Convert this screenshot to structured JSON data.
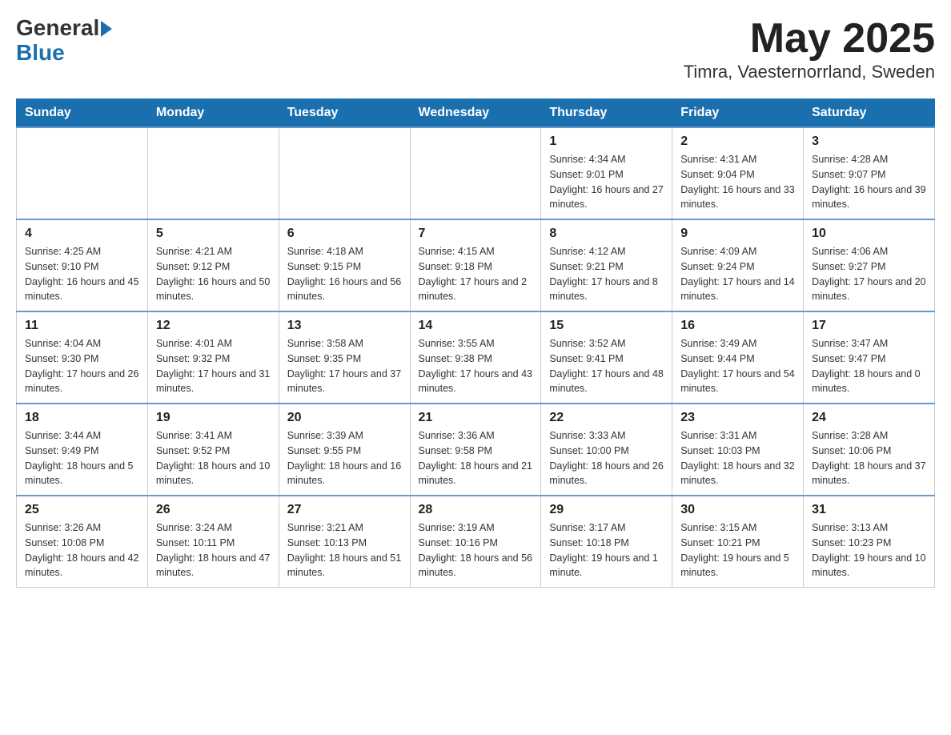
{
  "header": {
    "logo_general": "General",
    "logo_blue": "Blue",
    "title": "May 2025",
    "subtitle": "Timra, Vaesternorrland, Sweden"
  },
  "days_of_week": [
    "Sunday",
    "Monday",
    "Tuesday",
    "Wednesday",
    "Thursday",
    "Friday",
    "Saturday"
  ],
  "weeks": [
    [
      {
        "day": "",
        "info": ""
      },
      {
        "day": "",
        "info": ""
      },
      {
        "day": "",
        "info": ""
      },
      {
        "day": "",
        "info": ""
      },
      {
        "day": "1",
        "info": "Sunrise: 4:34 AM\nSunset: 9:01 PM\nDaylight: 16 hours and 27 minutes."
      },
      {
        "day": "2",
        "info": "Sunrise: 4:31 AM\nSunset: 9:04 PM\nDaylight: 16 hours and 33 minutes."
      },
      {
        "day": "3",
        "info": "Sunrise: 4:28 AM\nSunset: 9:07 PM\nDaylight: 16 hours and 39 minutes."
      }
    ],
    [
      {
        "day": "4",
        "info": "Sunrise: 4:25 AM\nSunset: 9:10 PM\nDaylight: 16 hours and 45 minutes."
      },
      {
        "day": "5",
        "info": "Sunrise: 4:21 AM\nSunset: 9:12 PM\nDaylight: 16 hours and 50 minutes."
      },
      {
        "day": "6",
        "info": "Sunrise: 4:18 AM\nSunset: 9:15 PM\nDaylight: 16 hours and 56 minutes."
      },
      {
        "day": "7",
        "info": "Sunrise: 4:15 AM\nSunset: 9:18 PM\nDaylight: 17 hours and 2 minutes."
      },
      {
        "day": "8",
        "info": "Sunrise: 4:12 AM\nSunset: 9:21 PM\nDaylight: 17 hours and 8 minutes."
      },
      {
        "day": "9",
        "info": "Sunrise: 4:09 AM\nSunset: 9:24 PM\nDaylight: 17 hours and 14 minutes."
      },
      {
        "day": "10",
        "info": "Sunrise: 4:06 AM\nSunset: 9:27 PM\nDaylight: 17 hours and 20 minutes."
      }
    ],
    [
      {
        "day": "11",
        "info": "Sunrise: 4:04 AM\nSunset: 9:30 PM\nDaylight: 17 hours and 26 minutes."
      },
      {
        "day": "12",
        "info": "Sunrise: 4:01 AM\nSunset: 9:32 PM\nDaylight: 17 hours and 31 minutes."
      },
      {
        "day": "13",
        "info": "Sunrise: 3:58 AM\nSunset: 9:35 PM\nDaylight: 17 hours and 37 minutes."
      },
      {
        "day": "14",
        "info": "Sunrise: 3:55 AM\nSunset: 9:38 PM\nDaylight: 17 hours and 43 minutes."
      },
      {
        "day": "15",
        "info": "Sunrise: 3:52 AM\nSunset: 9:41 PM\nDaylight: 17 hours and 48 minutes."
      },
      {
        "day": "16",
        "info": "Sunrise: 3:49 AM\nSunset: 9:44 PM\nDaylight: 17 hours and 54 minutes."
      },
      {
        "day": "17",
        "info": "Sunrise: 3:47 AM\nSunset: 9:47 PM\nDaylight: 18 hours and 0 minutes."
      }
    ],
    [
      {
        "day": "18",
        "info": "Sunrise: 3:44 AM\nSunset: 9:49 PM\nDaylight: 18 hours and 5 minutes."
      },
      {
        "day": "19",
        "info": "Sunrise: 3:41 AM\nSunset: 9:52 PM\nDaylight: 18 hours and 10 minutes."
      },
      {
        "day": "20",
        "info": "Sunrise: 3:39 AM\nSunset: 9:55 PM\nDaylight: 18 hours and 16 minutes."
      },
      {
        "day": "21",
        "info": "Sunrise: 3:36 AM\nSunset: 9:58 PM\nDaylight: 18 hours and 21 minutes."
      },
      {
        "day": "22",
        "info": "Sunrise: 3:33 AM\nSunset: 10:00 PM\nDaylight: 18 hours and 26 minutes."
      },
      {
        "day": "23",
        "info": "Sunrise: 3:31 AM\nSunset: 10:03 PM\nDaylight: 18 hours and 32 minutes."
      },
      {
        "day": "24",
        "info": "Sunrise: 3:28 AM\nSunset: 10:06 PM\nDaylight: 18 hours and 37 minutes."
      }
    ],
    [
      {
        "day": "25",
        "info": "Sunrise: 3:26 AM\nSunset: 10:08 PM\nDaylight: 18 hours and 42 minutes."
      },
      {
        "day": "26",
        "info": "Sunrise: 3:24 AM\nSunset: 10:11 PM\nDaylight: 18 hours and 47 minutes."
      },
      {
        "day": "27",
        "info": "Sunrise: 3:21 AM\nSunset: 10:13 PM\nDaylight: 18 hours and 51 minutes."
      },
      {
        "day": "28",
        "info": "Sunrise: 3:19 AM\nSunset: 10:16 PM\nDaylight: 18 hours and 56 minutes."
      },
      {
        "day": "29",
        "info": "Sunrise: 3:17 AM\nSunset: 10:18 PM\nDaylight: 19 hours and 1 minute."
      },
      {
        "day": "30",
        "info": "Sunrise: 3:15 AM\nSunset: 10:21 PM\nDaylight: 19 hours and 5 minutes."
      },
      {
        "day": "31",
        "info": "Sunrise: 3:13 AM\nSunset: 10:23 PM\nDaylight: 19 hours and 10 minutes."
      }
    ]
  ]
}
